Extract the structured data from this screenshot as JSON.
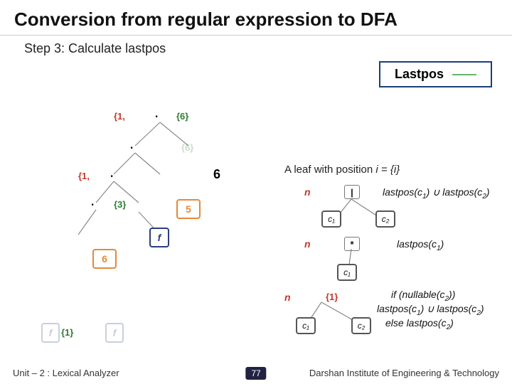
{
  "title": "Conversion from regular expression to DFA",
  "step": "Step 3: Calculate lastpos",
  "legend": {
    "label": "Lastpos"
  },
  "leaf_rule": {
    "text_prefix": "A leaf with position ",
    "math": "i = {i}"
  },
  "tree": {
    "root_set_left": "{1,",
    "root_op": "∙",
    "root_set_right": "{6}",
    "n2_op": "∙",
    "n2_right": "{6}",
    "n3_set_left": "{1,",
    "n3_op": "∙",
    "n3_right": "6",
    "n4_op": "∙",
    "n4_right": "{3}",
    "n5_label": "5",
    "f_label": "f",
    "n6_label": "6",
    "f2": "f",
    "f2_set": "{1}",
    "f3": "f"
  },
  "rules": {
    "union": {
      "n": "n",
      "op": "|",
      "formula_l": "lastpos(c",
      "s1": "1",
      "mid": ") ∪ lastpos(c",
      "s2": "2",
      "end": ")",
      "c1": "c₁",
      "c2": "c₂"
    },
    "star": {
      "n": "n",
      "op": "*",
      "formula_l": "lastpos(c",
      "s1": "1",
      "end": ")",
      "c1": "c₁"
    },
    "concat": {
      "n": "n",
      "pos_set": "{1}",
      "c1": "c₁",
      "c2": "c₂",
      "line1a": "if (nullable(c",
      "line1b": "2",
      "line1c": "))",
      "line2a": "lastpos(c",
      "line2b": "1",
      "line2c": ") ∪ lastpos(c",
      "line2d": "2",
      "line2e": ")",
      "line3a": "else lastpos(c",
      "line3b": "2",
      "line3c": ")"
    }
  },
  "footer": {
    "left": "Unit – 2  : Lexical Analyzer",
    "page": "77",
    "right": "Darshan Institute of Engineering & Technology"
  }
}
